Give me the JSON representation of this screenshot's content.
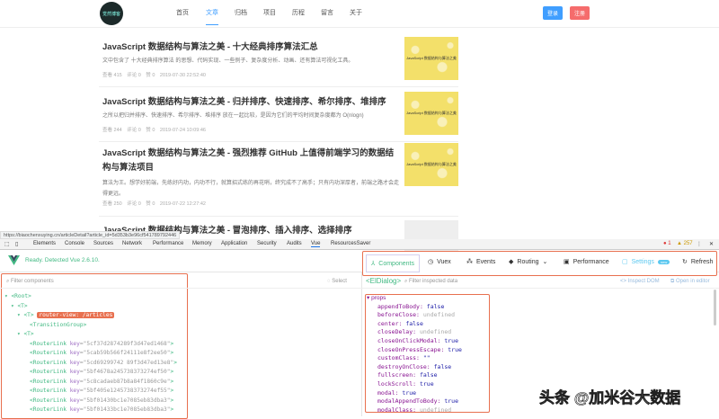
{
  "nav": {
    "logo": "觉然博客",
    "items": [
      "首页",
      "文章",
      "归档",
      "项目",
      "历程",
      "留言",
      "关于"
    ],
    "active": 1,
    "login": "登录",
    "register": "注册"
  },
  "articles": [
    {
      "title": "JavaScript 数据结构与算法之美 - 十大经典排序算法汇总",
      "desc": "文中包含了 十大经典排序算法 的思想、代码实现、一些例子、复杂度分析、动画、还有算法可视化工具。",
      "meta": "查看 415　评论 0　赞 0　2019-07-30 22:52:40",
      "thumb": "JavaScript 数据结构与算法之美"
    },
    {
      "title": "JavaScript 数据结构与算法之美 - 归并排序、快速排序、希尔排序、堆排序",
      "desc": "之所以把归并排序、快速排序、希尔排序、堆排序 放在一起比较，是因为它们的平均时间复杂度都为 O(nlogn)",
      "meta": "查看 244　评论 0　赞 0　2019-07-24 10:09:46",
      "thumb": "JavaScript 数据结构与算法之美"
    },
    {
      "title": "JavaScript 数据结构与算法之美 - 强烈推荐 GitHub 上值得前端学习的数据结构与算法项目",
      "desc": "算法为王。想学好前端，先练好内功，内功不行，就算招式练的再花哨，终究成不了高手；只有内功深厚者，前端之路才会走得更远。",
      "meta": "查看 250　评论 0　赞 0　2019-07-22 12:27:42",
      "thumb": "JavaScript 数据结构与算法之美"
    },
    {
      "title": "JavaScript 数据结构与算法之美 - 冒泡排序、插入排序、选择排序"
    }
  ],
  "url": "https://biaochenxuying.cn/articleDetail?article_id=5d353b3e96cf541789792446",
  "devtools": {
    "tabs": [
      "Elements",
      "Console",
      "Sources",
      "Network",
      "Performance",
      "Memory",
      "Application",
      "Security",
      "Audits",
      "Vue",
      "ResourcesSaver"
    ],
    "active": "Vue",
    "errors": "1",
    "warnings": "257"
  },
  "vue": {
    "status": "Ready. Detected Vue 2.6.10.",
    "toolbar": [
      "Components",
      "Vuex",
      "Events",
      "Routing",
      "Performance",
      "Settings",
      "Refresh"
    ],
    "settings_badge": "new",
    "filter_placeholder": "Filter components",
    "select": "Select",
    "selected": "<ElDialog>",
    "inspect_placeholder": "Filter inspected data",
    "inspect_dom": "<> Inspect DOM",
    "open_editor": "Open in editor"
  },
  "tree": {
    "root": "<Root>",
    "t1": "<T>",
    "t2": "<T>",
    "router_badge": "router-view: /articles",
    "transition": "<TransitionGroup>",
    "t3": "<T>",
    "links": [
      "5cf37d2874289f3d47ed1468",
      "5cab59b566f24111e8f2ee50",
      "5cd69299742 89f3d47ed13e8",
      "5bf4678a245738373274ef50",
      "5c8cadaeb87b8a84f1860c9e",
      "5bf405e1245738373274ef55",
      "5bf01430bc1e7085eb83dba3",
      "5bf01433bc1e7085eb83dba3"
    ]
  },
  "props": {
    "header": "props",
    "items": [
      [
        "appendToBody",
        "false"
      ],
      [
        "beforeClose",
        "undefined"
      ],
      [
        "center",
        "false"
      ],
      [
        "closeDelay",
        "undefined"
      ],
      [
        "closeOnClickModal",
        "true"
      ],
      [
        "closeOnPressEscape",
        "true"
      ],
      [
        "customClass",
        "\"\""
      ],
      [
        "destroyOnClose",
        "false"
      ],
      [
        "fullscreen",
        "false"
      ],
      [
        "lockScroll",
        "true"
      ],
      [
        "modal",
        "true"
      ],
      [
        "modalAppendToBody",
        "true"
      ],
      [
        "modalClass",
        "undefined"
      ]
    ]
  },
  "watermark": "头条 @加米谷大数据"
}
